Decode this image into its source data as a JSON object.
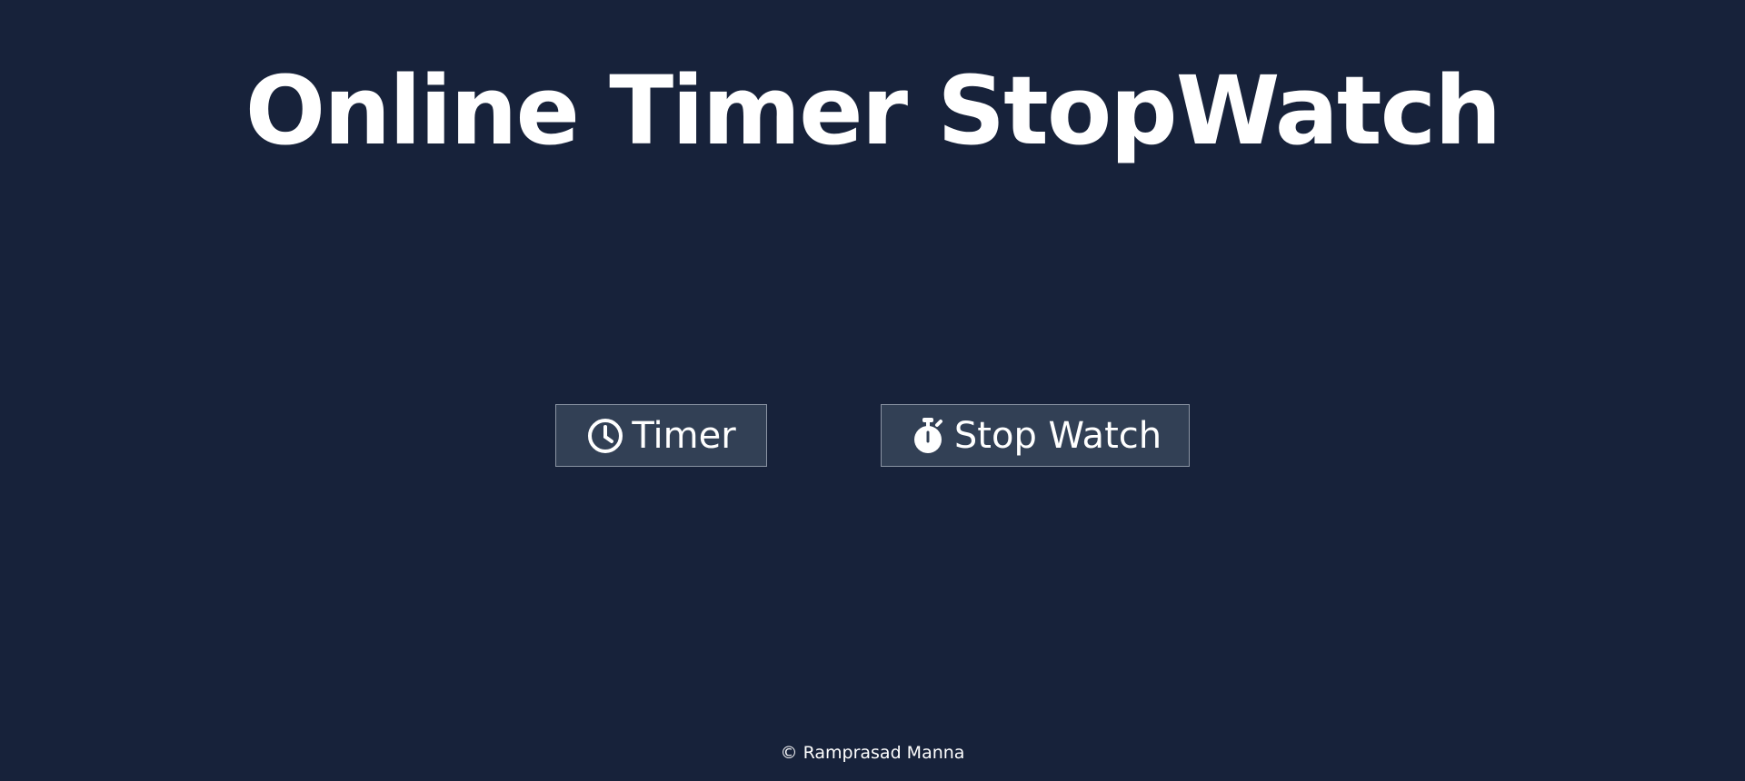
{
  "page": {
    "title": "Online Timer StopWatch",
    "background_color": "#17223a",
    "button_color": "#324055"
  },
  "buttons": {
    "timer": {
      "label": "Timer",
      "icon": "clock-icon"
    },
    "stopwatch": {
      "label": "Stop Watch",
      "icon": "stopwatch-icon"
    }
  },
  "footer": {
    "copyright": "© Ramprasad Manna"
  }
}
